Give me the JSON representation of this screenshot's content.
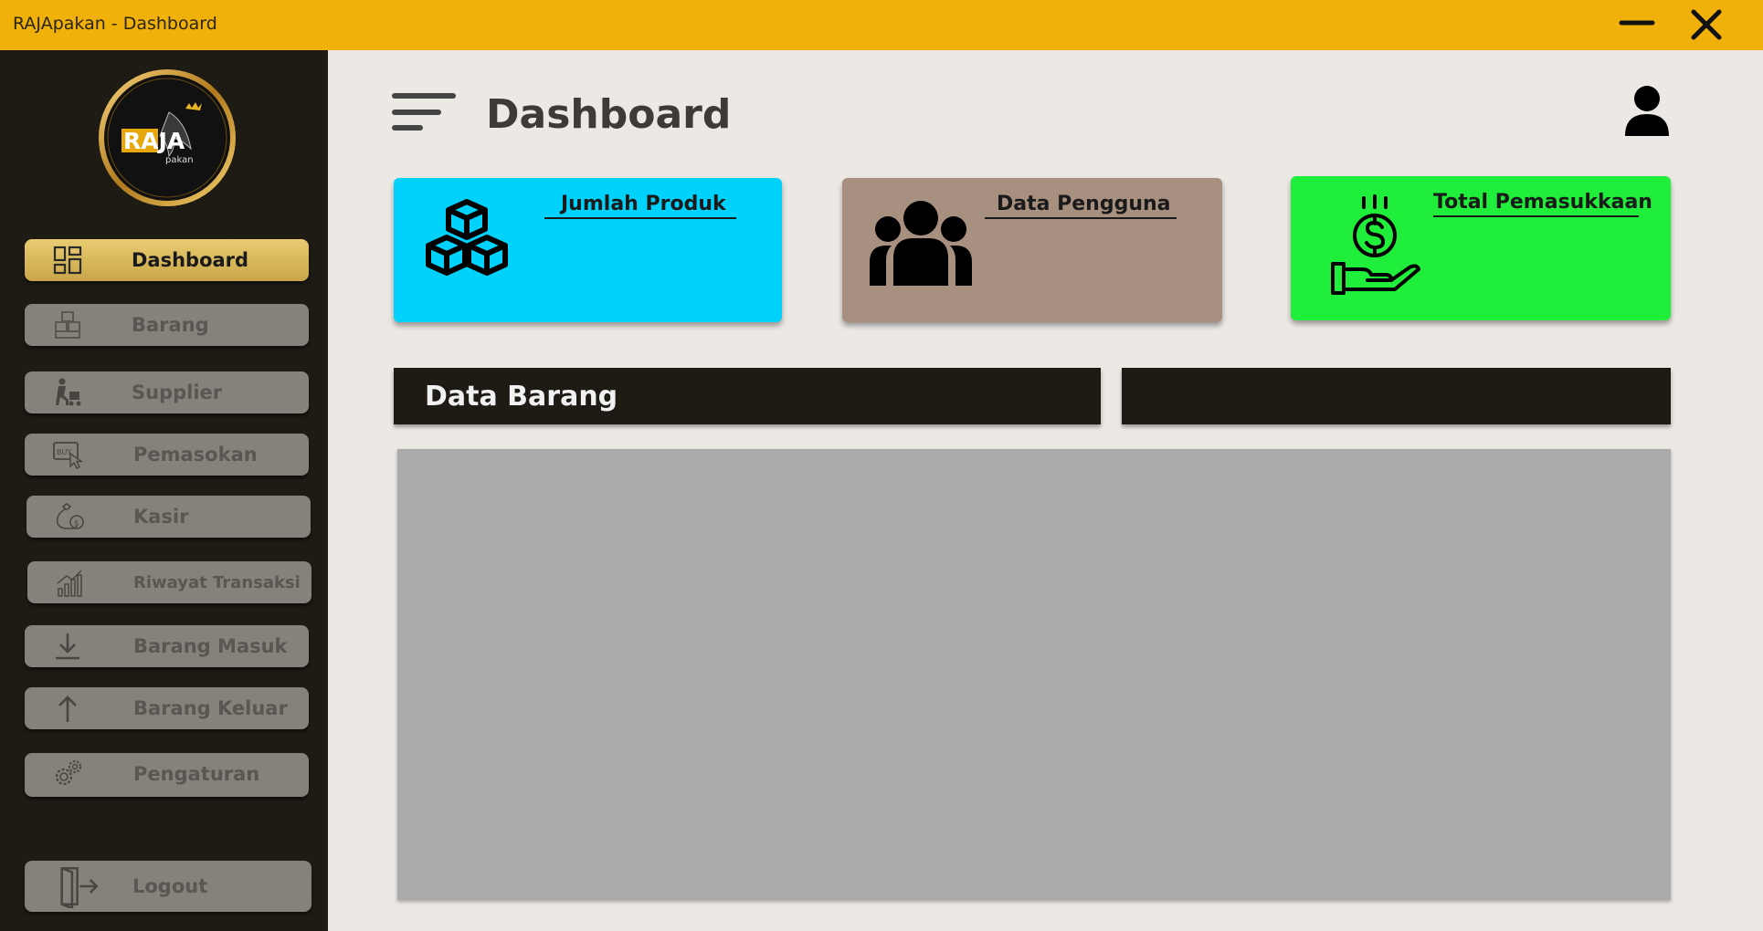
{
  "window": {
    "title": "RAJApakan - Dashboard"
  },
  "logo": {
    "text": "RAJA",
    "subtext": "pakan"
  },
  "sidebar": {
    "items": [
      {
        "label": "Dashboard",
        "icon": "dashboard-grid-icon"
      },
      {
        "label": "Barang",
        "icon": "boxes-icon"
      },
      {
        "label": "Supplier",
        "icon": "delivery-person-icon"
      },
      {
        "label": "Pemasokan",
        "icon": "buy-click-icon"
      },
      {
        "label": "Kasir",
        "icon": "money-bag-icon"
      },
      {
        "label": "Riwayat Transaksi",
        "icon": "bar-chart-growth-icon"
      },
      {
        "label": "Barang Masuk",
        "icon": "arrow-down-icon"
      },
      {
        "label": "Barang Keluar",
        "icon": "arrow-up-icon"
      },
      {
        "label": "Pengaturan",
        "icon": "gears-icon"
      }
    ],
    "logout": {
      "label": "Logout",
      "icon": "logout-door-icon"
    }
  },
  "header": {
    "title": "Dashboard"
  },
  "cards": [
    {
      "label": "Jumlah Produk",
      "color": "#00d2fb",
      "icon": "boxes-icon"
    },
    {
      "label": "Data Pengguna",
      "color": "#a89080",
      "icon": "users-group-icon"
    },
    {
      "label": "Total Pemasukkaan",
      "color": "#1fee3a",
      "icon": "money-hand-icon"
    }
  ],
  "panels": {
    "data_barang_title": "Data Barang"
  },
  "colors": {
    "titlebar": "#f0b10b",
    "sidebar": "#1e1b15",
    "active_nav": "#d9b95c",
    "nav": "#86817b",
    "background": "#ece8e4"
  }
}
